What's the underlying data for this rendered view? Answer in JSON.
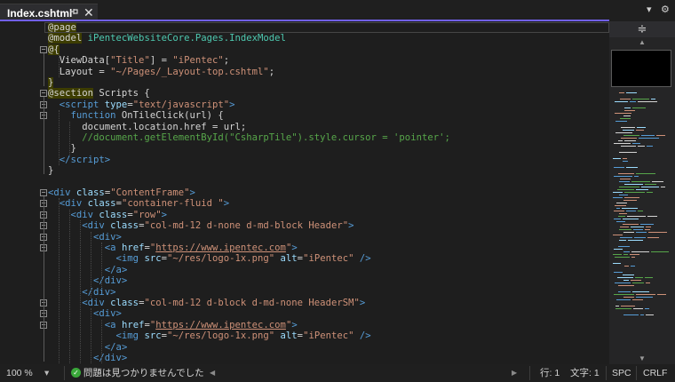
{
  "tab": {
    "title": "Index.cshtml",
    "pin_icon": "pin-icon",
    "close_icon": "close-icon"
  },
  "toolbar": {
    "dropdown_icon": "chevron-down-icon",
    "settings_icon": "gear-icon",
    "split_icon": "split-view-icon"
  },
  "colors": {
    "accent": "#7160e8",
    "background": "#1e1e1e",
    "keyword": "#569cd6",
    "string": "#ce9178",
    "comment": "#57a64a"
  },
  "code": {
    "lines": [
      [
        {
          "t": "@page",
          "c": "dir"
        }
      ],
      [
        {
          "t": "@model",
          "c": "dir"
        },
        {
          "t": " iPentecWebsiteCore.Pages.IndexModel",
          "c": "ns"
        }
      ],
      [
        {
          "t": "@{",
          "c": "dir"
        }
      ],
      [
        {
          "t": "  ViewData[",
          "c": ""
        },
        {
          "t": "\"Title\"",
          "c": "str"
        },
        {
          "t": "] = ",
          "c": ""
        },
        {
          "t": "\"iPentec\"",
          "c": "str"
        },
        {
          "t": ";",
          "c": ""
        }
      ],
      [
        {
          "t": "  Layout = ",
          "c": ""
        },
        {
          "t": "\"~/Pages/_Layout-top.cshtml\"",
          "c": "str"
        },
        {
          "t": ";",
          "c": ""
        }
      ],
      [
        {
          "t": "}",
          "c": "dir"
        }
      ],
      [
        {
          "t": "@section",
          "c": "dir"
        },
        {
          "t": " Scripts {",
          "c": ""
        }
      ],
      [
        {
          "t": "  <",
          "c": "tag"
        },
        {
          "t": "script",
          "c": "tag"
        },
        {
          "t": " type",
          "c": "attr"
        },
        {
          "t": "=",
          "c": ""
        },
        {
          "t": "\"text/javascript\"",
          "c": "str"
        },
        {
          "t": ">",
          "c": "tag"
        }
      ],
      [
        {
          "t": "    function",
          "c": "kw"
        },
        {
          "t": " OnTileClick(url) {",
          "c": ""
        }
      ],
      [
        {
          "t": "      document.location.href = url;",
          "c": ""
        }
      ],
      [
        {
          "t": "      //document.getElementById(\"CsharpTile\").style.cursor = 'pointer';",
          "c": "cmt"
        }
      ],
      [
        {
          "t": "    }",
          "c": ""
        }
      ],
      [
        {
          "t": "  </",
          "c": "tag"
        },
        {
          "t": "script",
          "c": "tag"
        },
        {
          "t": ">",
          "c": "tag"
        }
      ],
      [
        {
          "t": "}",
          "c": ""
        }
      ],
      [
        {
          "t": "",
          "c": ""
        }
      ],
      [
        {
          "t": "<",
          "c": "tag"
        },
        {
          "t": "div",
          "c": "tag"
        },
        {
          "t": " class",
          "c": "attr"
        },
        {
          "t": "=",
          "c": ""
        },
        {
          "t": "\"ContentFrame\"",
          "c": "str"
        },
        {
          "t": ">",
          "c": "tag"
        }
      ],
      [
        {
          "t": "  <",
          "c": "tag"
        },
        {
          "t": "div",
          "c": "tag"
        },
        {
          "t": " class",
          "c": "attr"
        },
        {
          "t": "=",
          "c": ""
        },
        {
          "t": "\"container-fluid \"",
          "c": "str"
        },
        {
          "t": ">",
          "c": "tag"
        }
      ],
      [
        {
          "t": "    <",
          "c": "tag"
        },
        {
          "t": "div",
          "c": "tag"
        },
        {
          "t": " class",
          "c": "attr"
        },
        {
          "t": "=",
          "c": ""
        },
        {
          "t": "\"row\"",
          "c": "str"
        },
        {
          "t": ">",
          "c": "tag"
        }
      ],
      [
        {
          "t": "      <",
          "c": "tag"
        },
        {
          "t": "div",
          "c": "tag"
        },
        {
          "t": " class",
          "c": "attr"
        },
        {
          "t": "=",
          "c": ""
        },
        {
          "t": "\"col-md-12 d-none d-md-block Header\"",
          "c": "str"
        },
        {
          "t": ">",
          "c": "tag"
        }
      ],
      [
        {
          "t": "        <",
          "c": "tag"
        },
        {
          "t": "div",
          "c": "tag"
        },
        {
          "t": ">",
          "c": "tag"
        }
      ],
      [
        {
          "t": "          <",
          "c": "tag"
        },
        {
          "t": "a",
          "c": "tag"
        },
        {
          "t": " href",
          "c": "attr"
        },
        {
          "t": "=",
          "c": ""
        },
        {
          "t": "\"",
          "c": "str"
        },
        {
          "t": "https://www.ipentec.com",
          "c": "link"
        },
        {
          "t": "\"",
          "c": "str"
        },
        {
          "t": ">",
          "c": "tag"
        }
      ],
      [
        {
          "t": "            <",
          "c": "tag"
        },
        {
          "t": "img",
          "c": "tag"
        },
        {
          "t": " src",
          "c": "attr"
        },
        {
          "t": "=",
          "c": ""
        },
        {
          "t": "\"~/res/logo-1x.png\"",
          "c": "str"
        },
        {
          "t": " alt",
          "c": "attr"
        },
        {
          "t": "=",
          "c": ""
        },
        {
          "t": "\"iPentec\"",
          "c": "str"
        },
        {
          "t": " />",
          "c": "tag"
        }
      ],
      [
        {
          "t": "          </",
          "c": "tag"
        },
        {
          "t": "a",
          "c": "tag"
        },
        {
          "t": ">",
          "c": "tag"
        }
      ],
      [
        {
          "t": "        </",
          "c": "tag"
        },
        {
          "t": "div",
          "c": "tag"
        },
        {
          "t": ">",
          "c": "tag"
        }
      ],
      [
        {
          "t": "      </",
          "c": "tag"
        },
        {
          "t": "div",
          "c": "tag"
        },
        {
          "t": ">",
          "c": "tag"
        }
      ],
      [
        {
          "t": "      <",
          "c": "tag"
        },
        {
          "t": "div",
          "c": "tag"
        },
        {
          "t": " class",
          "c": "attr"
        },
        {
          "t": "=",
          "c": ""
        },
        {
          "t": "\"col-md-12 d-block d-md-none HeaderSM\"",
          "c": "str"
        },
        {
          "t": ">",
          "c": "tag"
        }
      ],
      [
        {
          "t": "        <",
          "c": "tag"
        },
        {
          "t": "div",
          "c": "tag"
        },
        {
          "t": ">",
          "c": "tag"
        }
      ],
      [
        {
          "t": "          <",
          "c": "tag"
        },
        {
          "t": "a",
          "c": "tag"
        },
        {
          "t": " href",
          "c": "attr"
        },
        {
          "t": "=",
          "c": ""
        },
        {
          "t": "\"",
          "c": "str"
        },
        {
          "t": "https://www.ipentec.com",
          "c": "link"
        },
        {
          "t": "\"",
          "c": "str"
        },
        {
          "t": ">",
          "c": "tag"
        }
      ],
      [
        {
          "t": "            <",
          "c": "tag"
        },
        {
          "t": "img",
          "c": "tag"
        },
        {
          "t": " src",
          "c": "attr"
        },
        {
          "t": "=",
          "c": ""
        },
        {
          "t": "\"~/res/logo-1x.png\"",
          "c": "str"
        },
        {
          "t": " alt",
          "c": "attr"
        },
        {
          "t": "=",
          "c": ""
        },
        {
          "t": "\"iPentec\"",
          "c": "str"
        },
        {
          "t": " />",
          "c": "tag"
        }
      ],
      [
        {
          "t": "          </",
          "c": "tag"
        },
        {
          "t": "a",
          "c": "tag"
        },
        {
          "t": ">",
          "c": "tag"
        }
      ],
      [
        {
          "t": "        </",
          "c": "tag"
        },
        {
          "t": "div",
          "c": "tag"
        },
        {
          "t": ">",
          "c": "tag"
        }
      ]
    ]
  },
  "status": {
    "zoom": "100 %",
    "issues_icon": "check-circle-icon",
    "issues_text": "問題は見つかりませんでした",
    "line": "行: 1",
    "char": "文字: 1",
    "spacing": "SPC",
    "line_ending": "CRLF"
  }
}
